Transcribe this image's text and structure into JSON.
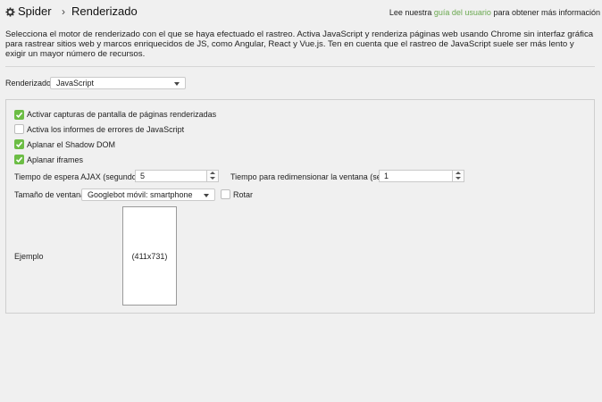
{
  "header": {
    "gear_icon": "gear-icon",
    "breadcrumb_root": "Spider",
    "breadcrumb_separator": "›",
    "breadcrumb_page": "Renderizado",
    "help_prefix": "Lee nuestra",
    "help_link": "guía del usuario",
    "help_suffix": "para obtener más información"
  },
  "intro": "Selecciona el motor de renderizado con el que se haya efectuado el rastreo. Activa JavaScript y renderiza páginas web usando Chrome sin interfaz gráfica para rastrear sitios web y marcos enriquecidos de JS, como Angular, React y Vue.js. Ten en cuenta que el rastreo de JavaScript suele ser más lento y exigir un mayor número de recursos.",
  "rendering": {
    "label": "Renderizado",
    "value": "JavaScript"
  },
  "options": [
    {
      "label": "Activar capturas de pantalla de páginas renderizadas",
      "checked": true
    },
    {
      "label": "Activa los informes de errores de JavaScript",
      "checked": false
    },
    {
      "label": "Aplanar el Shadow DOM",
      "checked": true
    },
    {
      "label": "Aplanar iframes",
      "checked": true
    }
  ],
  "ajax_timeout": {
    "label": "Tiempo de espera AJAX (segundos)",
    "value": "5"
  },
  "resize_time": {
    "label": "Tiempo para redimensionar la ventana (seg.)",
    "value": "1"
  },
  "window_size": {
    "label": "Tamaño de ventana",
    "value": "Googlebot móvil: smartphone"
  },
  "rotate": {
    "label": "Rotar",
    "checked": false
  },
  "example": {
    "label": "Ejemplo",
    "size": "(411x731)"
  },
  "colors": {
    "accent": "#6cbd45",
    "link": "#6aa84f"
  }
}
